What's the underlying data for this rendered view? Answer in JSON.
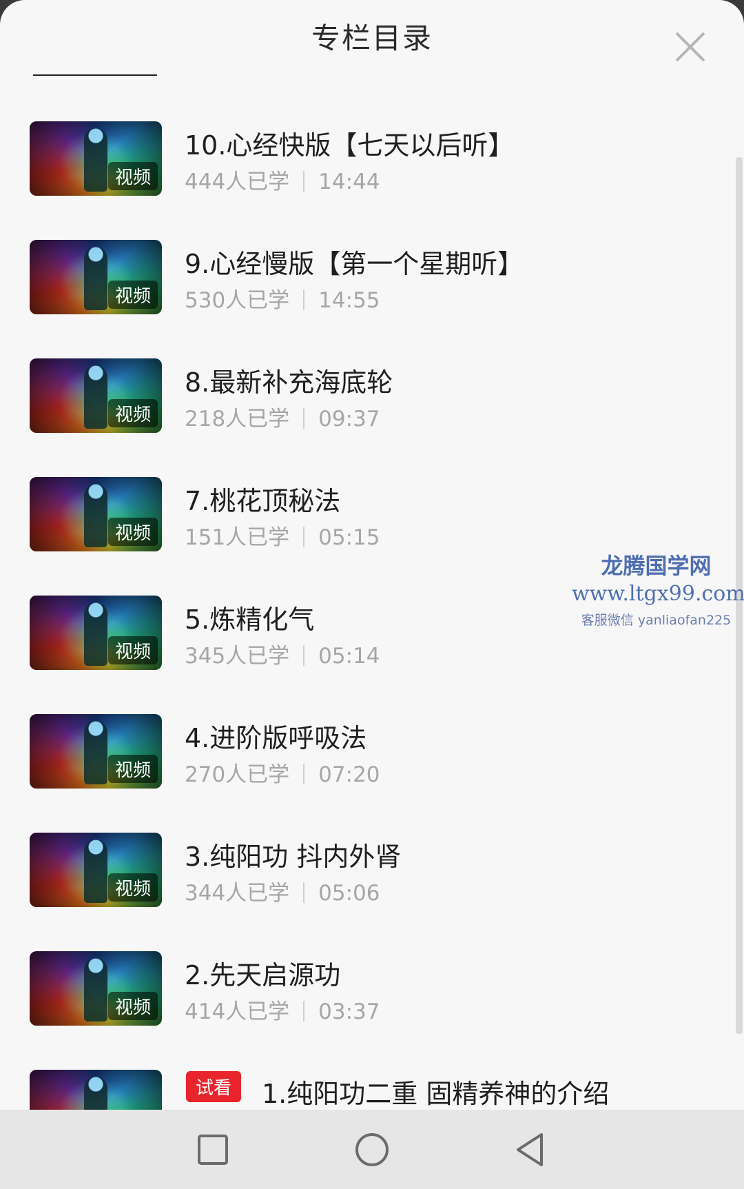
{
  "header": {
    "title": "专栏目录"
  },
  "badge_label": "视频",
  "trial_label": "试看",
  "items": [
    {
      "title": "10.心经快版【七天以后听】",
      "learners": "444人已学",
      "duration": "14:44"
    },
    {
      "title": "9.心经慢版【第一个星期听】",
      "learners": "530人已学",
      "duration": "14:55"
    },
    {
      "title": "8.最新补充海底轮",
      "learners": "218人已学",
      "duration": "09:37"
    },
    {
      "title": "7.桃花顶秘法",
      "learners": "151人已学",
      "duration": "05:15"
    },
    {
      "title": "5.炼精化气",
      "learners": "345人已学",
      "duration": "05:14"
    },
    {
      "title": "4.进阶版呼吸法",
      "learners": "270人已学",
      "duration": "07:20"
    },
    {
      "title": "3.纯阳功 抖内外肾",
      "learners": "344人已学",
      "duration": "05:06"
    },
    {
      "title": "2.先天启源功",
      "learners": "414人已学",
      "duration": "03:37"
    },
    {
      "title": "1.纯阳功二重 固精养神的介绍"
    }
  ],
  "watermark": {
    "name": "龙腾国学网",
    "url": "www.ltgx99.com",
    "contact": "客服微信 yanliaofan225"
  },
  "icons": {
    "close": "close-icon",
    "nav_recent": "square-icon",
    "nav_home": "circle-icon",
    "nav_back": "triangle-back-icon"
  }
}
